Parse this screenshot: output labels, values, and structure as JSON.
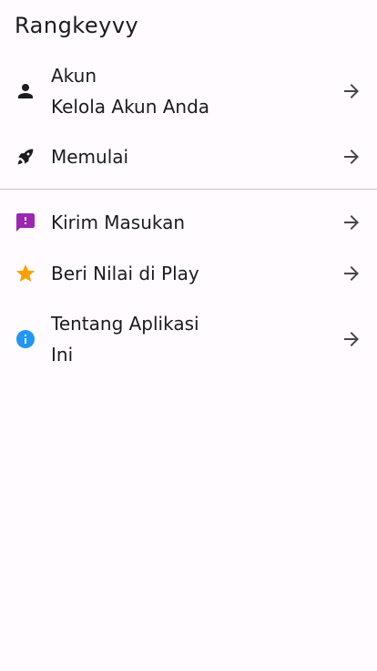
{
  "header": {
    "title": "Rangkeyvy"
  },
  "items": [
    {
      "id": "account",
      "icon": "person-icon",
      "icon_color": "#1c1b1f",
      "line1": "Akun",
      "line2": "Kelola Akun Anda"
    },
    {
      "id": "getting-started",
      "icon": "rocket-icon",
      "icon_color": "#1c1b1f",
      "line1": "Memulai"
    },
    {
      "id": "feedback",
      "icon": "feedback-icon",
      "icon_color": "#9c27b0",
      "line1": "Kirim Masukan"
    },
    {
      "id": "rate",
      "icon": "star-icon",
      "icon_color": "#f9a000",
      "line1": "Beri Nilai di Play"
    },
    {
      "id": "about",
      "icon": "info-icon",
      "icon_color": "#2196f3",
      "line1": "Tentang Aplikasi",
      "line2": "Ini"
    }
  ],
  "colors": {
    "background": "#fffbfe",
    "text": "#1c1b1f",
    "divider": "#cac4d0",
    "arrow": "#49454f"
  }
}
